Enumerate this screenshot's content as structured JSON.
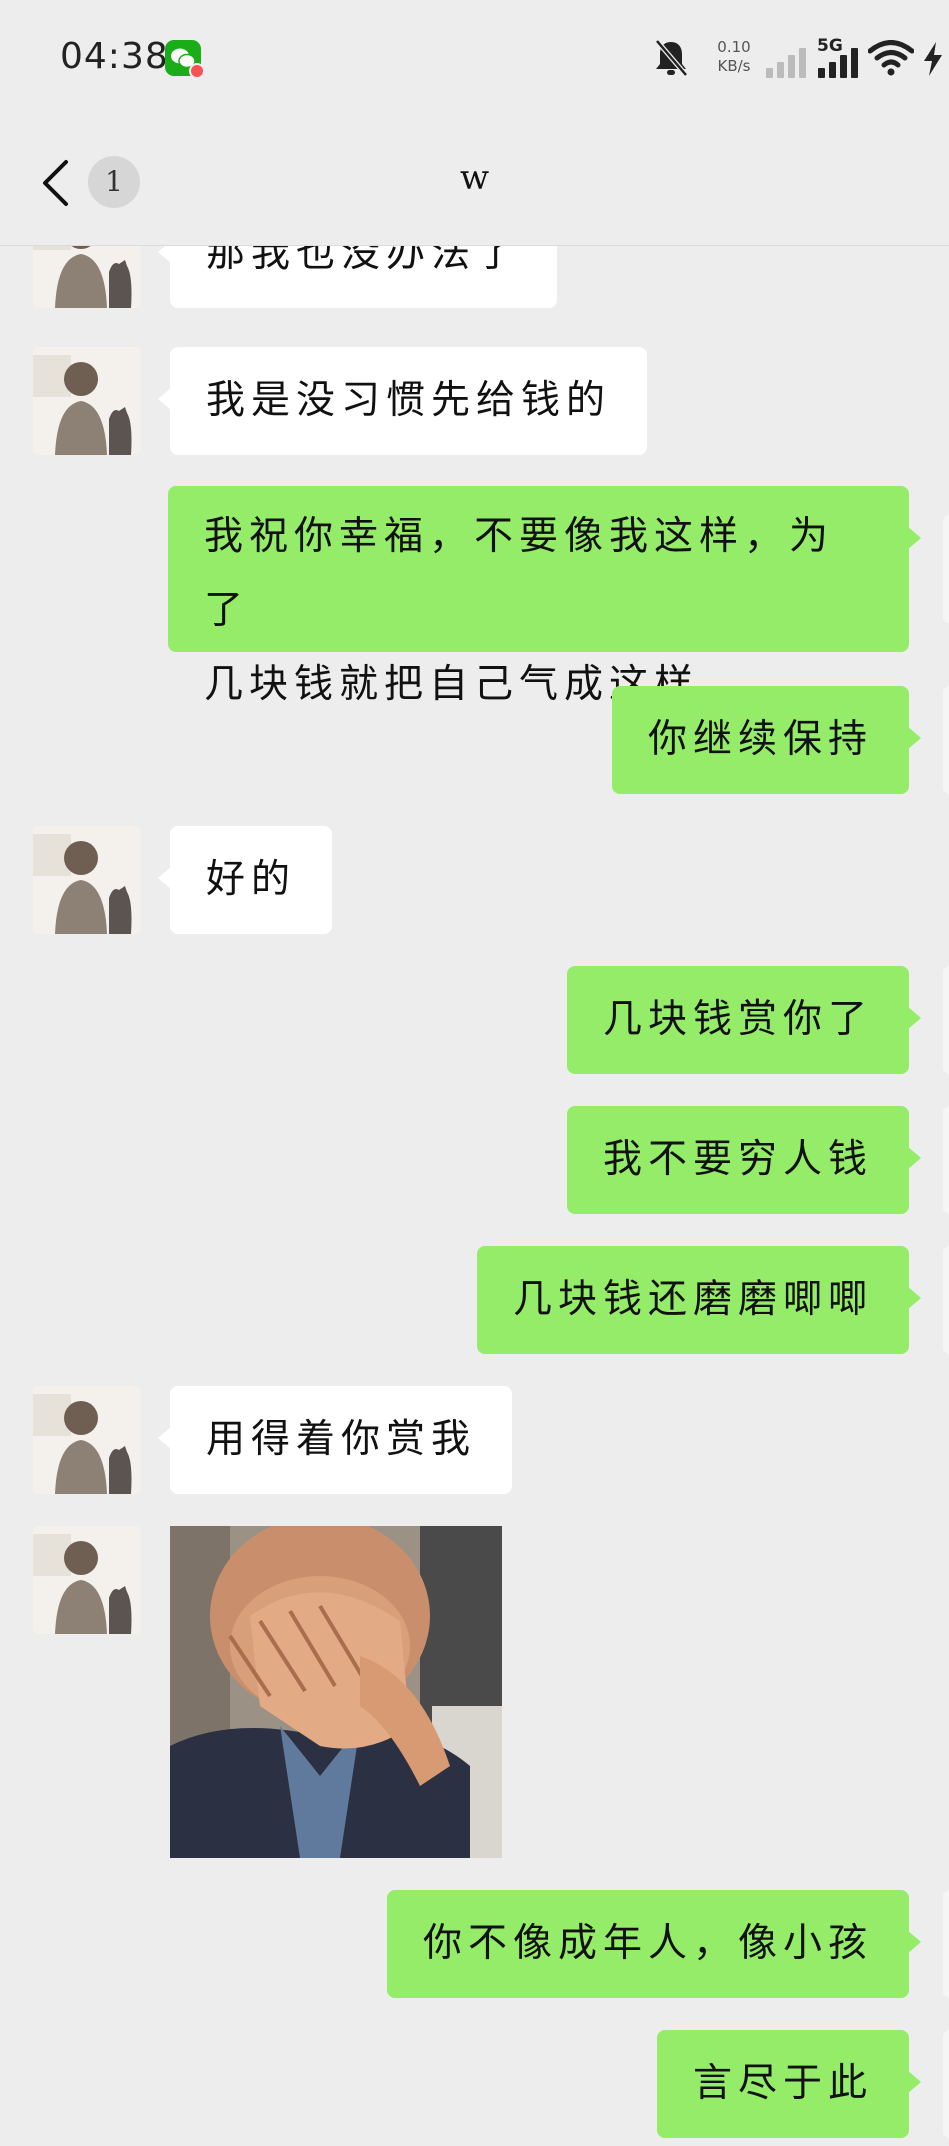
{
  "status_bar": {
    "time": "04:38",
    "net_speed_value": "0.10",
    "net_speed_unit": "KB/s",
    "network_type": "5G"
  },
  "nav": {
    "unread_count": "1",
    "title": "w"
  },
  "messages": [
    {
      "side": "in",
      "text": "那我也没办法了"
    },
    {
      "side": "in",
      "text": "我是没习惯先给钱的"
    },
    {
      "side": "out",
      "lines": [
        "我祝你幸福，不要像我这样，为了",
        "几块钱就把自己气成这样"
      ]
    },
    {
      "side": "out",
      "text": "你继续保持"
    },
    {
      "side": "in",
      "text": "好的"
    },
    {
      "side": "out",
      "text": "几块钱赏你了"
    },
    {
      "side": "out",
      "text": "我不要穷人钱"
    },
    {
      "side": "out",
      "text": "几块钱还磨磨唧唧"
    },
    {
      "side": "in",
      "text": "用得着你赏我"
    },
    {
      "side": "in",
      "type": "sticker",
      "icon": "facepalm-sticker"
    },
    {
      "side": "out",
      "text": "你不像成年人，像小孩"
    },
    {
      "side": "out",
      "text": "言尽于此"
    }
  ],
  "colors": {
    "background": "#ededed",
    "outgoing_bubble": "#95ec69",
    "incoming_bubble": "#ffffff",
    "wechat_green": "#1aad19"
  }
}
